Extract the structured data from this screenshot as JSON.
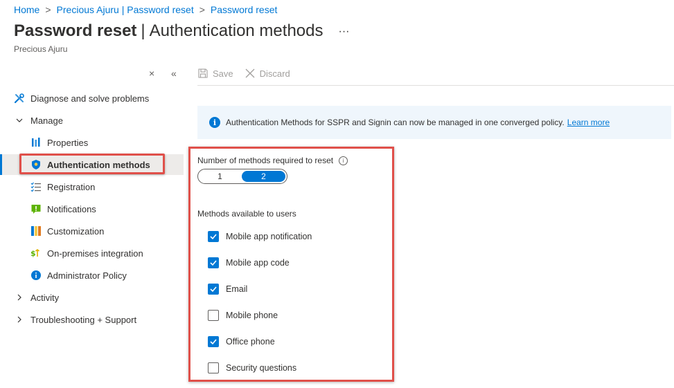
{
  "breadcrumb": [
    {
      "label": "Home"
    },
    {
      "label": "Precious Ajuru | Password reset"
    },
    {
      "label": "Password reset"
    }
  ],
  "page": {
    "title_bold": "Password reset",
    "title_rest": "Authentication methods",
    "more": "···",
    "subtitle": "Precious Ajuru"
  },
  "sidebar": {
    "pin": "×",
    "collapse": "«",
    "items": [
      {
        "label": "Diagnose and solve problems",
        "icon": "wrench-icon"
      },
      {
        "label": "Manage",
        "icon": "chevron-down-icon"
      },
      {
        "label": "Properties",
        "icon": "properties-icon"
      },
      {
        "label": "Authentication methods",
        "icon": "shield-icon"
      },
      {
        "label": "Registration",
        "icon": "checklist-icon"
      },
      {
        "label": "Notifications",
        "icon": "notification-icon"
      },
      {
        "label": "Customization",
        "icon": "customization-icon"
      },
      {
        "label": "On-premises integration",
        "icon": "integration-icon"
      },
      {
        "label": "Administrator Policy",
        "icon": "info-icon"
      },
      {
        "label": "Activity",
        "icon": "chevron-right-icon"
      },
      {
        "label": "Troubleshooting + Support",
        "icon": "chevron-right-icon"
      }
    ]
  },
  "toolbar": {
    "save": "Save",
    "discard": "Discard"
  },
  "info": {
    "text": "Authentication Methods for SSPR and Signin can now be managed in one converged policy.",
    "link": "Learn more"
  },
  "form": {
    "methods_required_label": "Number of methods required to reset",
    "toggle_options": [
      "1",
      "2"
    ],
    "toggle_selected": "2",
    "methods_available_label": "Methods available to users",
    "methods": [
      {
        "label": "Mobile app notification",
        "checked": true
      },
      {
        "label": "Mobile app code",
        "checked": true
      },
      {
        "label": "Email",
        "checked": true
      },
      {
        "label": "Mobile phone",
        "checked": false
      },
      {
        "label": "Office phone",
        "checked": true
      },
      {
        "label": "Security questions",
        "checked": false
      }
    ]
  },
  "colors": {
    "accent": "#0078d4",
    "highlight": "#e0504a",
    "selected_bg": "#edebe9"
  }
}
